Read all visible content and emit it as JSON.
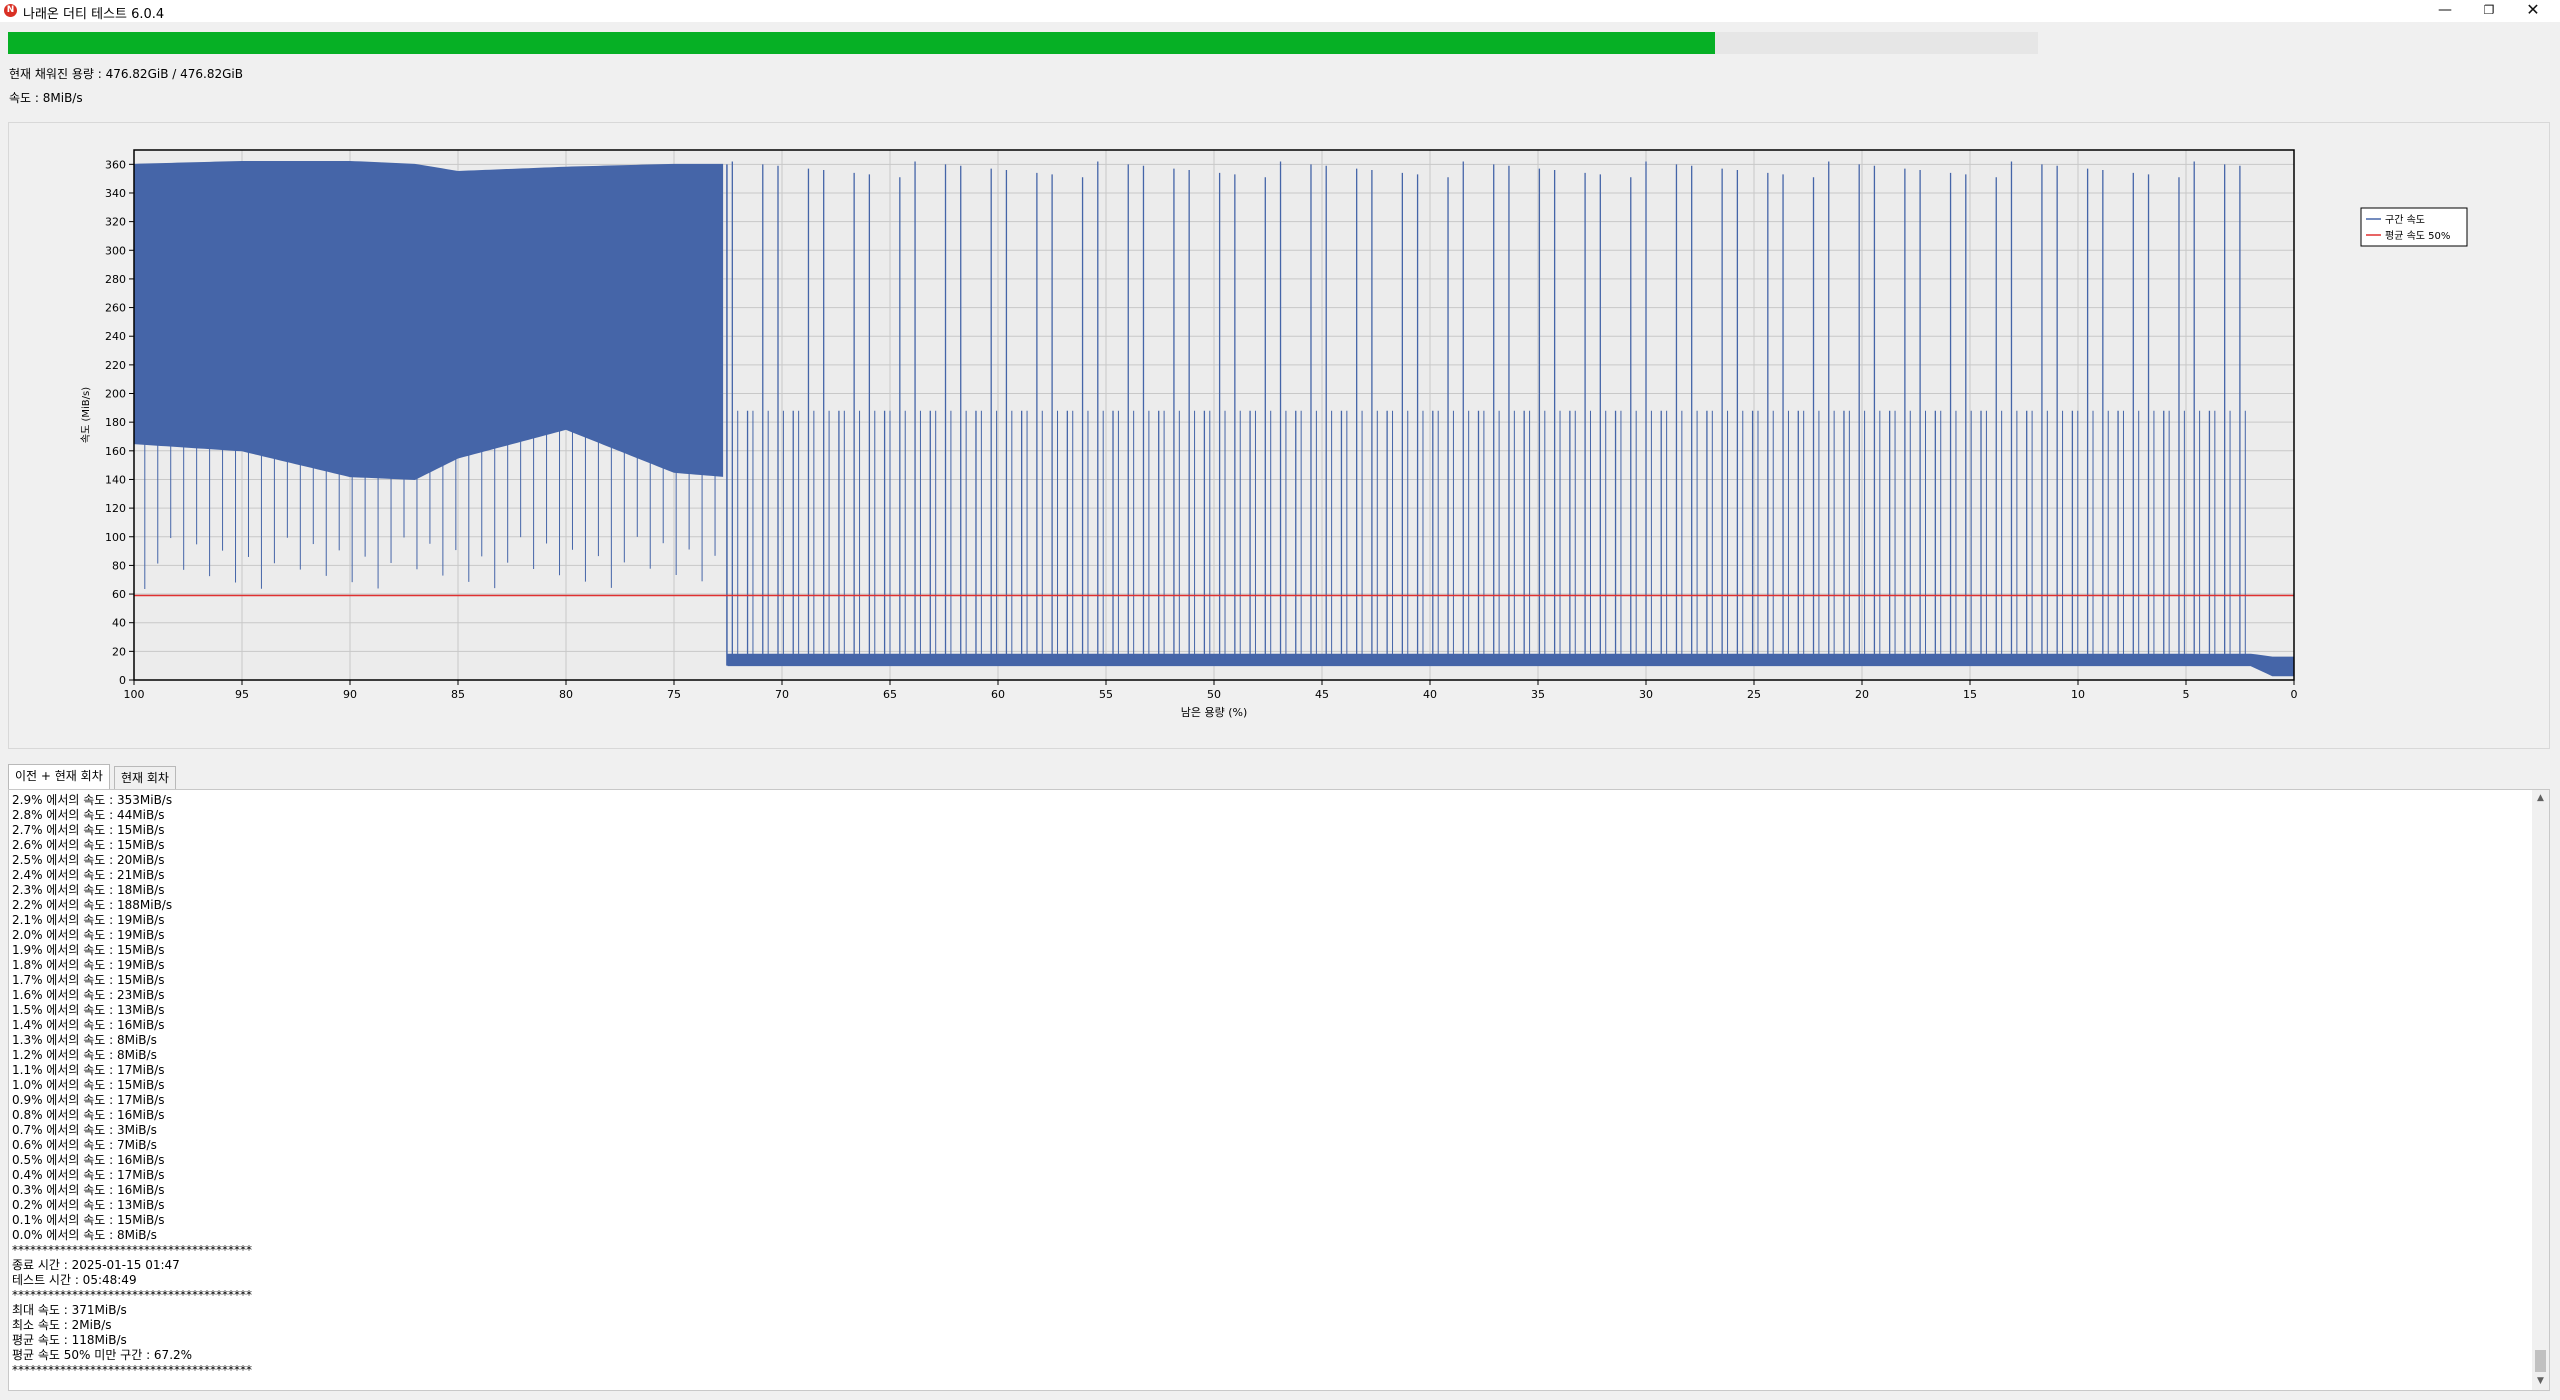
{
  "window": {
    "title": "나래온 더티 테스트 6.0.4",
    "icon": "app-logo-icon",
    "controls": [
      "minimize-icon",
      "restore-icon",
      "close-icon"
    ]
  },
  "progress": {
    "fraction": 0.841,
    "color": "#06b025"
  },
  "info": {
    "capacity": "현재 채워진 용량 : 476.82GiB / 476.82GiB",
    "speed": "속도 : 8MiB/s"
  },
  "chart_data": {
    "type": "line",
    "xlabel": "남은 용량 (%)",
    "ylabel": "속도 (MiB/s)",
    "xlim": [
      100,
      0
    ],
    "ylim": [
      0,
      370
    ],
    "x_ticks": [
      "100",
      "95",
      "90",
      "85",
      "80",
      "75",
      "70",
      "65",
      "60",
      "55",
      "50",
      "45",
      "40",
      "35",
      "30",
      "25",
      "20",
      "15",
      "10",
      "5",
      "0"
    ],
    "y_ticks": [
      "0",
      "20",
      "40",
      "60",
      "80",
      "100",
      "120",
      "140",
      "160",
      "180",
      "200",
      "220",
      "240",
      "260",
      "280",
      "300",
      "320",
      "340",
      "360"
    ],
    "grid": true,
    "legend_position": "right",
    "series": [
      {
        "name": "구간 속도",
        "color": "#4565a8",
        "description_points": {
          "x": [
            100,
            95,
            90,
            87,
            85,
            80,
            75,
            72.6,
            72.5,
            60,
            40,
            20,
            2,
            1,
            0
          ],
          "y_high": [
            360,
            362,
            362,
            360,
            355,
            358,
            360,
            360,
            18,
            18,
            18,
            18,
            18,
            16,
            16
          ],
          "y_low": [
            165,
            160,
            142,
            140,
            155,
            175,
            145,
            142,
            10,
            10,
            10,
            10,
            10,
            3,
            3
          ]
        },
        "spikes_after_72_5": {
          "count": 100,
          "peak": 362,
          "secondary": 188
        }
      },
      {
        "name": "평균 속도 50%",
        "color": "#e03030",
        "y": 59
      }
    ]
  },
  "tabs": [
    {
      "label": "이전 + 현재 회차",
      "active": true
    },
    {
      "label": "현재 회차",
      "active": false
    }
  ],
  "log": [
    "2.9% 에서의 속도 : 353MiB/s",
    "2.8% 에서의 속도 : 44MiB/s",
    "2.7% 에서의 속도 : 15MiB/s",
    "2.6% 에서의 속도 : 15MiB/s",
    "2.5% 에서의 속도 : 20MiB/s",
    "2.4% 에서의 속도 : 21MiB/s",
    "2.3% 에서의 속도 : 18MiB/s",
    "2.2% 에서의 속도 : 188MiB/s",
    "2.1% 에서의 속도 : 19MiB/s",
    "2.0% 에서의 속도 : 19MiB/s",
    "1.9% 에서의 속도 : 15MiB/s",
    "1.8% 에서의 속도 : 19MiB/s",
    "1.7% 에서의 속도 : 15MiB/s",
    "1.6% 에서의 속도 : 23MiB/s",
    "1.5% 에서의 속도 : 13MiB/s",
    "1.4% 에서의 속도 : 16MiB/s",
    "1.3% 에서의 속도 : 8MiB/s",
    "1.2% 에서의 속도 : 8MiB/s",
    "1.1% 에서의 속도 : 17MiB/s",
    "1.0% 에서의 속도 : 15MiB/s",
    "0.9% 에서의 속도 : 17MiB/s",
    "0.8% 에서의 속도 : 16MiB/s",
    "0.7% 에서의 속도 : 3MiB/s",
    "0.6% 에서의 속도 : 7MiB/s",
    "0.5% 에서의 속도 : 16MiB/s",
    "0.4% 에서의 속도 : 17MiB/s",
    "0.3% 에서의 속도 : 16MiB/s",
    "0.2% 에서의 속도 : 13MiB/s",
    "0.1% 에서의 속도 : 15MiB/s",
    "0.0% 에서의 속도 : 8MiB/s",
    "****************************************",
    "종료 시간 : 2025-01-15 01:47",
    "테스트 시간 : 05:48:49",
    "****************************************",
    "최대 속도 : 371MiB/s",
    "최소 속도 : 2MiB/s",
    "평균 속도 : 118MiB/s",
    "평균 속도 50% 미만 구간 : 67.2%",
    "****************************************"
  ],
  "scrollbar": {
    "position_fraction": 0.96
  }
}
